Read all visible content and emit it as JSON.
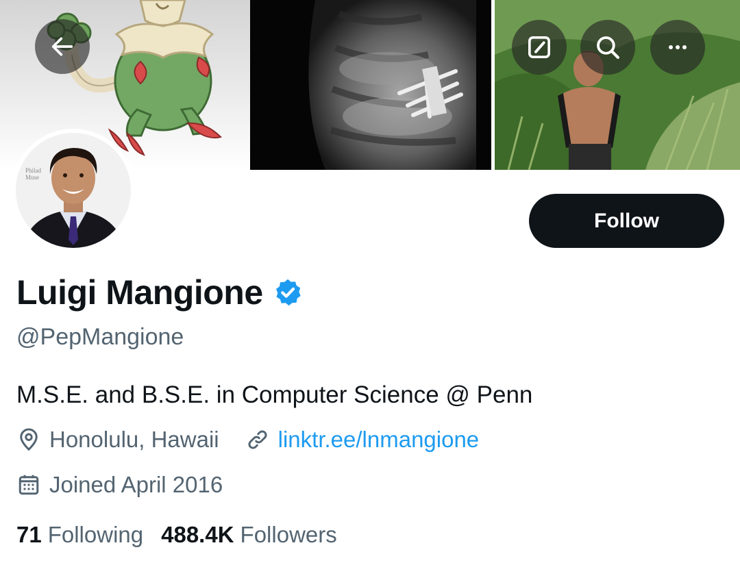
{
  "header": {
    "back_icon": "arrow-left-icon",
    "edit_icon": "edit-square-icon",
    "search_icon": "search-icon",
    "more_icon": "more-horizontal-icon"
  },
  "profile": {
    "display_name": "Luigi Mangione",
    "verified": true,
    "handle": "@PepMangione",
    "bio": "M.S.E. and B.S.E. in Computer Science @ Penn",
    "location": "Honolulu, Hawaii",
    "website": "linktr.ee/lnmangione",
    "joined": "Joined April 2016",
    "avatar_backdrop_text": [
      "Philad",
      "Muse"
    ]
  },
  "actions": {
    "follow_label": "Follow"
  },
  "stats": {
    "following_count": "71",
    "following_label": "Following",
    "followers_count": "488.4K",
    "followers_label": "Followers"
  },
  "colors": {
    "text_primary": "#0f1419",
    "text_secondary": "#536471",
    "link": "#1d9bf0",
    "verified_badge": "#1d9bf0",
    "follow_button_bg": "#0f1419",
    "follow_button_text": "#ffffff"
  }
}
